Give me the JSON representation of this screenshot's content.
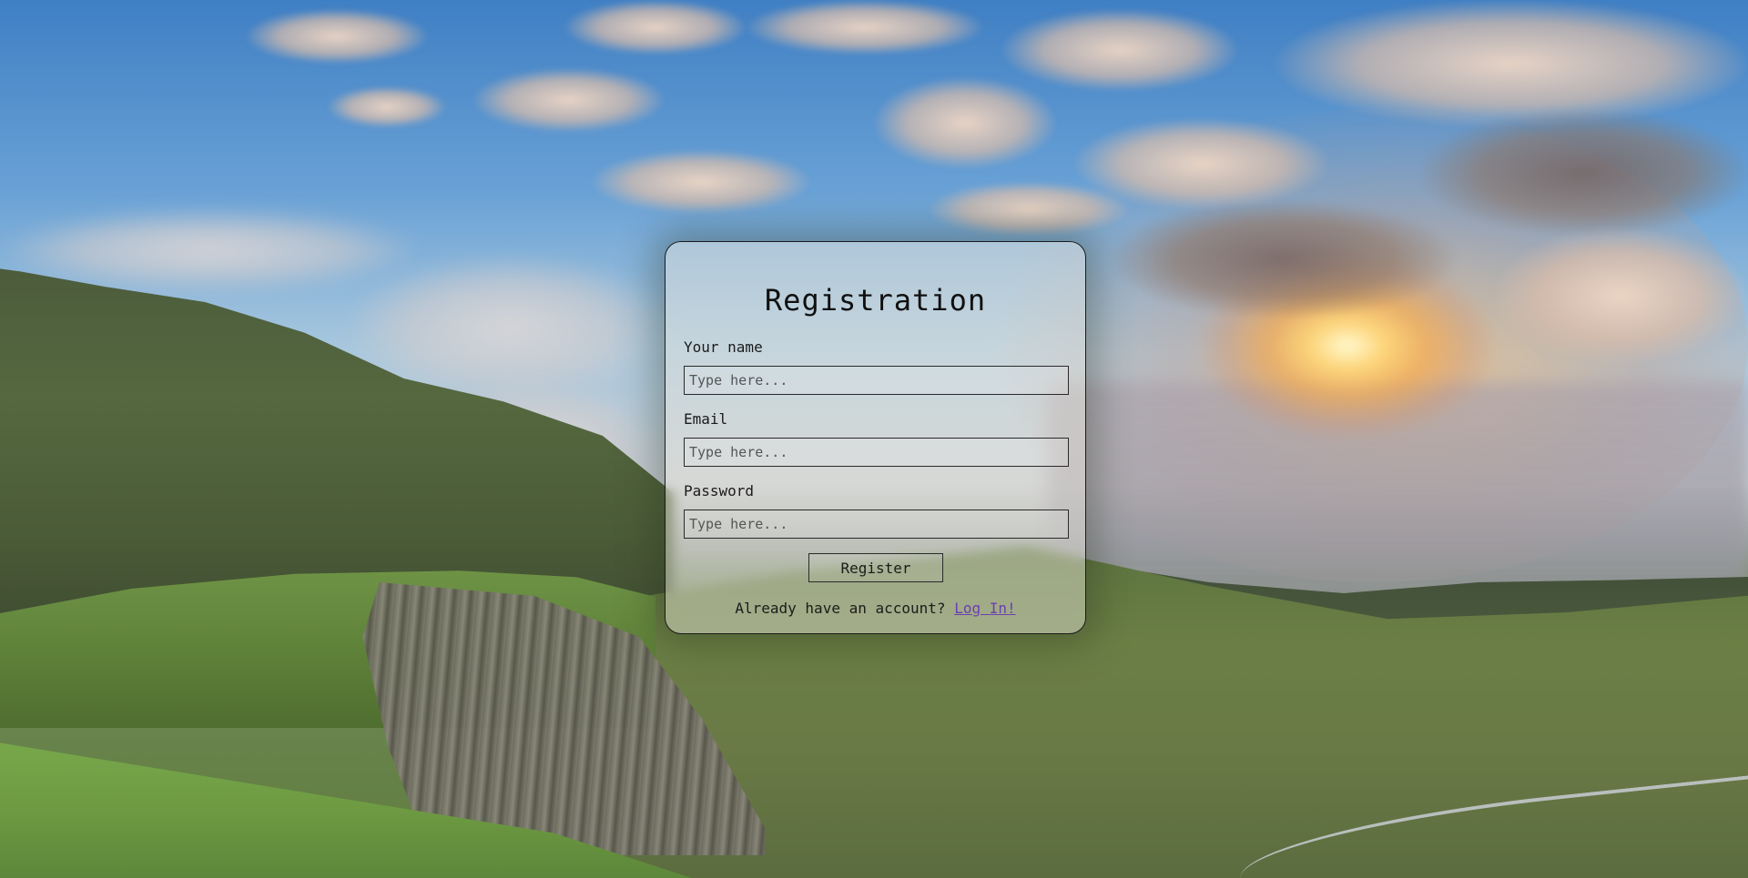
{
  "form": {
    "title": "Registration",
    "fields": [
      {
        "label": "Your name",
        "placeholder": "Type here...",
        "value": ""
      },
      {
        "label": "Email",
        "placeholder": "Type here...",
        "value": ""
      },
      {
        "label": "Password",
        "placeholder": "Type here...",
        "value": ""
      }
    ],
    "submit_label": "Register",
    "login_prompt": "Already have an account?",
    "login_link": "Log In!"
  },
  "colors": {
    "link": "#6a3fb0",
    "card_border": "#1a1a1a"
  }
}
